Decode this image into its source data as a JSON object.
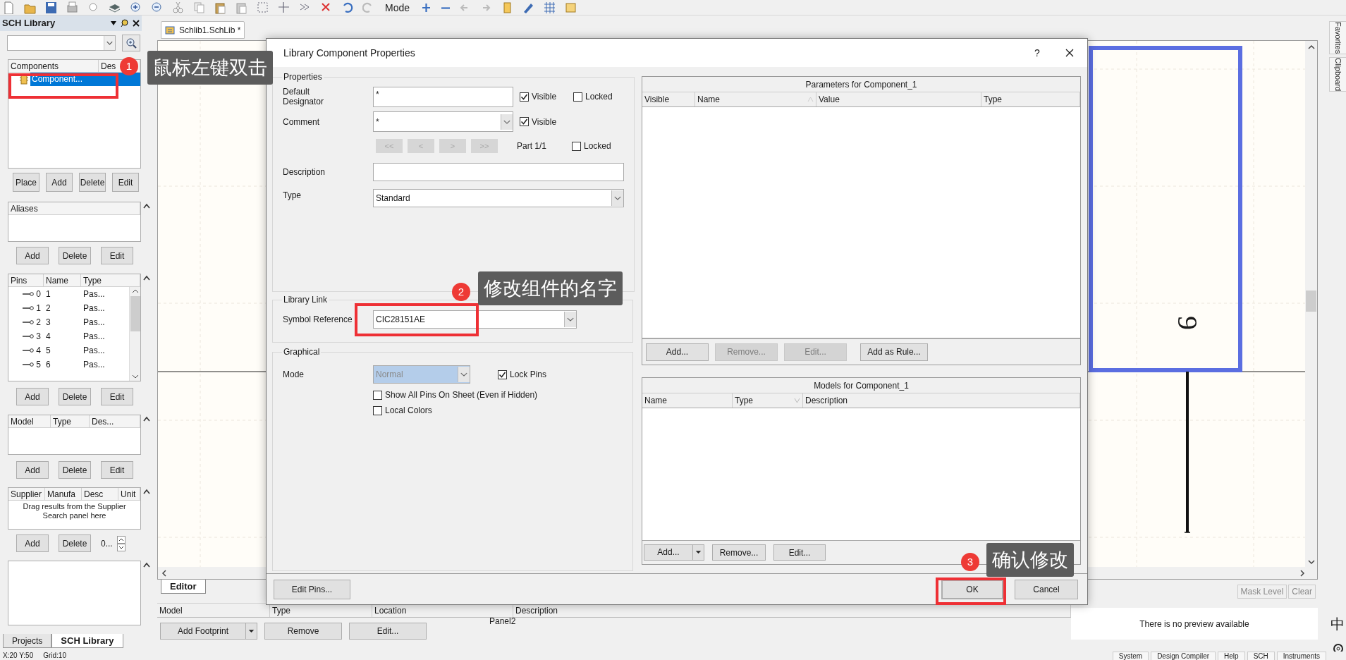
{
  "toolbar": {
    "mode_label": "Mode"
  },
  "sch_library_panel": {
    "title": "SCH Library",
    "components": {
      "columns": [
        "Components",
        "Des"
      ],
      "rows": [
        {
          "name": "Component...",
          "selected": true
        }
      ]
    },
    "component_buttons": [
      "Place",
      "Add",
      "Delete",
      "Edit"
    ],
    "aliases": {
      "columns": [
        "Aliases"
      ]
    },
    "alias_buttons": [
      "Add",
      "Delete",
      "Edit"
    ],
    "pins": {
      "columns": [
        "Pins",
        "Name",
        "Type"
      ],
      "rows": [
        {
          "pin": "0",
          "name": "1",
          "type": "Pas..."
        },
        {
          "pin": "1",
          "name": "2",
          "type": "Pas..."
        },
        {
          "pin": "2",
          "name": "3",
          "type": "Pas..."
        },
        {
          "pin": "3",
          "name": "4",
          "type": "Pas..."
        },
        {
          "pin": "4",
          "name": "5",
          "type": "Pas..."
        },
        {
          "pin": "5",
          "name": "6",
          "type": "Pas..."
        }
      ]
    },
    "pin_buttons": [
      "Add",
      "Delete",
      "Edit"
    ],
    "models": {
      "columns": [
        "Model",
        "Type",
        "Des..."
      ]
    },
    "model_buttons": [
      "Add",
      "Delete",
      "Edit"
    ],
    "suppliers": {
      "columns": [
        "Supplier",
        "Manufa",
        "Desc",
        "Unit"
      ],
      "hint": "Drag results from the Supplier Search panel here"
    },
    "supplier_buttons": [
      "Add",
      "Delete"
    ],
    "supplier_count": "0...",
    "tabs": [
      {
        "label": "Projects",
        "selected": false
      },
      {
        "label": "SCH Library",
        "selected": true
      }
    ]
  },
  "document_tab": {
    "label": "Schlib1.SchLib *"
  },
  "canvas": {
    "pin_number": "9"
  },
  "dialog": {
    "title": "Library Component Properties",
    "help": "?",
    "properties": {
      "legend": "Properties",
      "default_designator": {
        "label": "Default Designator",
        "value": "*",
        "visible_label": "Visible",
        "visible": true,
        "locked_label": "Locked",
        "locked": false
      },
      "comment": {
        "label": "Comment",
        "value": "*",
        "visible_label": "Visible",
        "visible": true
      },
      "part_nav": [
        {
          "label": "<<",
          "disabled": true
        },
        {
          "label": "<",
          "disabled": true
        },
        {
          "label": ">",
          "disabled": true
        },
        {
          "label": ">>",
          "disabled": true
        }
      ],
      "part": {
        "label": "Part 1/1",
        "locked_label": "Locked",
        "locked": false
      },
      "description": {
        "label": "Description"
      },
      "type": {
        "label": "Type",
        "value": "Standard"
      }
    },
    "library_link": {
      "legend": "Library Link",
      "label": "Symbol Reference",
      "value": "CIC28151AE"
    },
    "graphical": {
      "legend": "Graphical",
      "mode_label": "Mode",
      "mode_value": "Normal",
      "mode_disabled": true,
      "lock_pins": {
        "label": "Lock Pins",
        "checked": true
      },
      "options": [
        {
          "label": "Show All Pins On Sheet (Even if Hidden)",
          "checked": false
        },
        {
          "label": "Local Colors",
          "checked": false
        }
      ]
    },
    "parameters": {
      "title": "Parameters for Component_1",
      "columns": [
        "Visible",
        "Name",
        "Value",
        "Type"
      ],
      "buttons": [
        {
          "label": "Add...",
          "disabled": false
        },
        {
          "label": "Remove...",
          "disabled": true
        },
        {
          "label": "Edit...",
          "disabled": true
        },
        {
          "label": "Add as Rule...",
          "disabled": false
        }
      ]
    },
    "models": {
      "title": "Models for Component_1",
      "columns": [
        "Name",
        "Type",
        "Description"
      ],
      "buttons": [
        "Add...",
        "Remove...",
        "Edit..."
      ]
    },
    "edit_pins": "Edit Pins...",
    "ok": "OK",
    "cancel": "Cancel"
  },
  "editor_tab": {
    "label": "Editor",
    "selected": true
  },
  "footprints": {
    "columns": [
      "Model",
      "Type",
      "Location",
      "Description"
    ],
    "buttons": [
      "Add Footprint",
      "Remove",
      "Edit..."
    ],
    "note": "Panel2"
  },
  "mask_buttons": [
    "Mask Level",
    "Clear"
  ],
  "preview": "There is no preview available",
  "side_tabs": [
    "Favorites",
    "Clipboard"
  ],
  "ime_indicator": "中",
  "status_bar": {
    "position": "X:20 Y:50",
    "grid": "Grid:10",
    "panels": [
      "System",
      "Design Compiler",
      "Help",
      "SCH",
      "Instruments"
    ]
  },
  "annotations": [
    {
      "number": "1",
      "text": "鼠标左键双击"
    },
    {
      "number": "2",
      "text": "修改组件的名字"
    },
    {
      "number": "3",
      "text": "确认修改"
    }
  ]
}
